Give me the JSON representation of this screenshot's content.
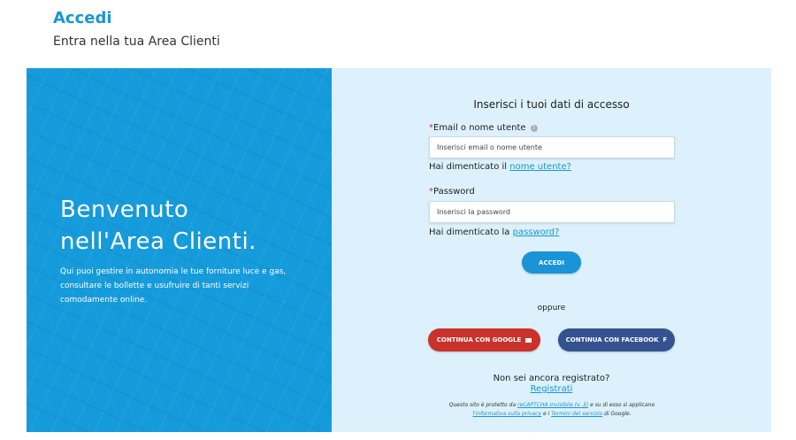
{
  "header": {
    "title": "Accedi",
    "subtitle": "Entra nella tua Area Clienti"
  },
  "welcome": {
    "title_line1": "Benvenuto",
    "title_line2": "nell'Area Clienti.",
    "text": "Qui puoi gestire in autonomia le tue forniture luce e gas, consultare le bollette e usufruire di tanti servizi comodamente online."
  },
  "form": {
    "heading": "Inserisci i tuoi dati di accesso",
    "email": {
      "required_mark": "*",
      "label": "Email o nome utente",
      "info_icon": "i",
      "placeholder": "Inserisci email o nome utente",
      "value": ""
    },
    "forgot_username": {
      "text": "Hai dimenticato il ",
      "link": "nome utente?"
    },
    "password": {
      "required_mark": "*",
      "label": "Password",
      "placeholder": "Inserisci la password",
      "value": ""
    },
    "forgot_password": {
      "text": "Hai dimenticato la ",
      "link": "password?"
    },
    "login_button": "ACCEDI",
    "separator": "oppure",
    "google_button": "CONTINUA CON GOOGLE",
    "facebook_button": "CONTINUA CON FACEBOOK",
    "facebook_icon": "f",
    "not_registered": "Non sei ancora registrato?",
    "register_link": "Registrati",
    "recaptcha": {
      "part1": "Questo sito è protetto da ",
      "link1": "reCAPTCHA Invisibile (v. 3)",
      "part2": " e su di esso si applicano ",
      "link2": "l'informativa sulla privacy",
      "part3": " e i ",
      "link3": "Termini del servizio",
      "part4": " di Google."
    }
  },
  "colors": {
    "brand_blue": "#1a94d6",
    "panel_blue": "#159bdc",
    "form_bg": "#dcf1fb",
    "google_red": "#c9322b",
    "facebook_blue": "#34528f"
  }
}
